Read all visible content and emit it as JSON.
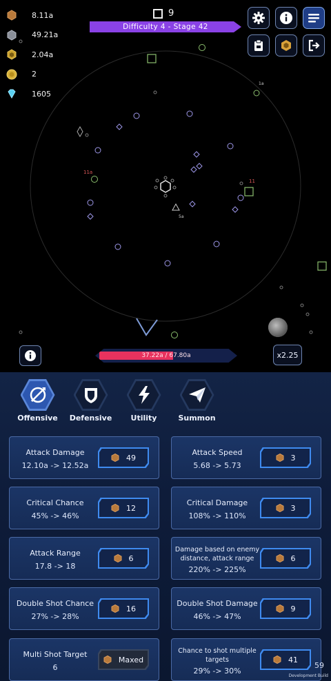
{
  "resources": [
    {
      "icon": "bronze-hexagon-icon",
      "value": "8.11a"
    },
    {
      "icon": "silver-hexagon-icon",
      "value": "49.21a"
    },
    {
      "icon": "gold-hexagon-icon",
      "value": "2.04a"
    },
    {
      "icon": "coin-icon",
      "value": "2"
    },
    {
      "icon": "diamond-gem-icon",
      "value": "1605"
    }
  ],
  "wave": {
    "count": "9"
  },
  "difficulty": {
    "label": "Difficulty 4 - Stage 42"
  },
  "top_buttons": {
    "settings": "gear-icon",
    "info": "info-icon",
    "menu": "menu-icon",
    "tasks": "clipboard-icon",
    "shop": "hexagon-shop-icon",
    "exit": "exit-icon"
  },
  "battle": {
    "floating_labels": [
      "11a",
      "11",
      "5a",
      "1a"
    ],
    "health": {
      "text": "37.22a / 67.80a",
      "fraction": 0.55
    }
  },
  "speed": {
    "label": "x2.25"
  },
  "tabs": [
    {
      "label": "Offensive",
      "icon": "offensive-icon",
      "active": true
    },
    {
      "label": "Defensive",
      "icon": "shield-icon",
      "active": false
    },
    {
      "label": "Utility",
      "icon": "lightning-icon",
      "active": false
    },
    {
      "label": "Summon",
      "icon": "paper-plane-icon",
      "active": false
    }
  ],
  "upgrades": [
    {
      "name": "Attack Damage",
      "value": "12.10a -> 12.52a",
      "cost": "49"
    },
    {
      "name": "Attack Speed",
      "value": "5.68 -> 5.73",
      "cost": "3"
    },
    {
      "name": "Critical Chance",
      "value": "45% -> 46%",
      "cost": "12"
    },
    {
      "name": "Critical Damage",
      "value": "108% -> 110%",
      "cost": "3"
    },
    {
      "name": "Attack Range",
      "value": "17.8 -> 18",
      "cost": "6"
    },
    {
      "name": "Damage based on enemy distance, attack range",
      "value": "220% -> 225%",
      "cost": "6"
    },
    {
      "name": "Double Shot Chance",
      "value": "27% -> 28%",
      "cost": "16"
    },
    {
      "name": "Double Shot Damage",
      "value": "46% -> 47%",
      "cost": "9"
    },
    {
      "name": "Multi Shot Target",
      "value": "6",
      "cost": "Maxed"
    },
    {
      "name": "Chance to shot multiple targets",
      "value": "29% -> 30%",
      "cost": "41"
    }
  ],
  "fps": "59",
  "build_label": "Development Build"
}
